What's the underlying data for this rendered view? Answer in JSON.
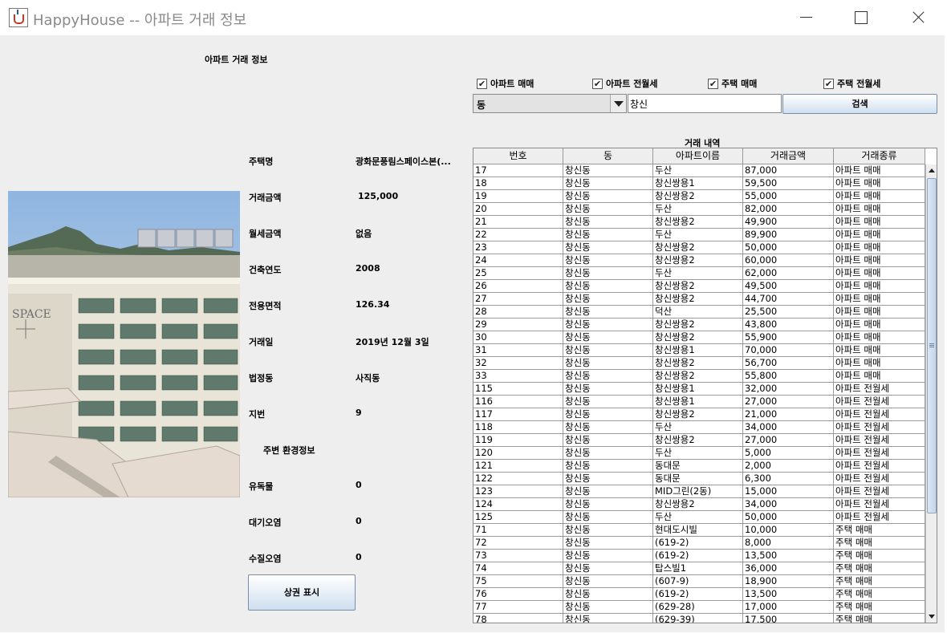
{
  "window": {
    "title": "HappyHouse -- 아파트 거래 정보",
    "icon": "java-cup-icon"
  },
  "header": {
    "title": "아파트 거래 정보"
  },
  "filters": {
    "checkboxes": [
      {
        "label": "아파트 매매",
        "checked": true
      },
      {
        "label": "아파트 전월세",
        "checked": true
      },
      {
        "label": "주택 매매",
        "checked": true
      },
      {
        "label": "주택 전월세",
        "checked": true
      }
    ],
    "check_mark": "✔",
    "category": {
      "selected": "동"
    },
    "query": {
      "value": "창신"
    },
    "search_label": "검색"
  },
  "detail": {
    "fields": [
      {
        "label": "주택명",
        "value": "광화문풍림스페이스본(..."
      },
      {
        "label": "거래금액",
        "value": "125,000"
      },
      {
        "label": "월세금액",
        "value": "없음"
      },
      {
        "label": "건축연도",
        "value": "2008"
      },
      {
        "label": "전용면적",
        "value": "126.34"
      },
      {
        "label": "거래일",
        "value": "2019년 12월 3일"
      },
      {
        "label": "법정동",
        "value": "사직동"
      },
      {
        "label": "지번",
        "value": "9"
      }
    ],
    "env_title": "주변 환경정보",
    "env_fields": [
      {
        "label": "유독물",
        "value": "0"
      },
      {
        "label": "대기오염",
        "value": "0"
      },
      {
        "label": "수질오염",
        "value": "0"
      }
    ],
    "map_button": "상권 표시",
    "photo_sign": "SPACE"
  },
  "deals": {
    "caption": "거래 내역",
    "columns": [
      "번호",
      "동",
      "아파트이름",
      "거래금액",
      "거래종류"
    ],
    "rows": [
      [
        "17",
        "창신동",
        "두산",
        "87,000",
        "아파트 매매"
      ],
      [
        "18",
        "창신동",
        "창신쌍용1",
        "59,500",
        "아파트 매매"
      ],
      [
        "19",
        "창신동",
        "창신쌍용2",
        "55,000",
        "아파트 매매"
      ],
      [
        "20",
        "창신동",
        "두산",
        "82,000",
        "아파트 매매"
      ],
      [
        "21",
        "창신동",
        "창신쌍용2",
        "49,900",
        "아파트 매매"
      ],
      [
        "22",
        "창신동",
        "두산",
        "89,900",
        "아파트 매매"
      ],
      [
        "23",
        "창신동",
        "창신쌍용2",
        "50,000",
        "아파트 매매"
      ],
      [
        "24",
        "창신동",
        "창신쌍용2",
        "60,000",
        "아파트 매매"
      ],
      [
        "25",
        "창신동",
        "두산",
        "62,000",
        "아파트 매매"
      ],
      [
        "26",
        "창신동",
        "창신쌍용2",
        "49,500",
        "아파트 매매"
      ],
      [
        "27",
        "창신동",
        "창신쌍용2",
        "44,700",
        "아파트 매매"
      ],
      [
        "28",
        "창신동",
        "덕산",
        "25,500",
        "아파트 매매"
      ],
      [
        "29",
        "창신동",
        "창신쌍용2",
        "43,800",
        "아파트 매매"
      ],
      [
        "30",
        "창신동",
        "창신쌍용2",
        "55,900",
        "아파트 매매"
      ],
      [
        "31",
        "창신동",
        "창신쌍용1",
        "70,000",
        "아파트 매매"
      ],
      [
        "32",
        "창신동",
        "창신쌍용2",
        "56,700",
        "아파트 매매"
      ],
      [
        "33",
        "창신동",
        "창신쌍용2",
        "55,800",
        "아파트 매매"
      ],
      [
        "115",
        "창신동",
        "창신쌍용1",
        "32,000",
        "아파트 전월세"
      ],
      [
        "116",
        "창신동",
        "창신쌍용1",
        "27,000",
        "아파트 전월세"
      ],
      [
        "117",
        "창신동",
        "창신쌍용2",
        "21,000",
        "아파트 전월세"
      ],
      [
        "118",
        "창신동",
        "두산",
        "34,000",
        "아파트 전월세"
      ],
      [
        "119",
        "창신동",
        "창신쌍용2",
        "27,000",
        "아파트 전월세"
      ],
      [
        "120",
        "창신동",
        "두산",
        "5,000",
        "아파트 전월세"
      ],
      [
        "121",
        "창신동",
        "동대문",
        "2,000",
        "아파트 전월세"
      ],
      [
        "122",
        "창신동",
        "동대문",
        "6,300",
        "아파트 전월세"
      ],
      [
        "123",
        "창신동",
        "MID그린(2동)",
        "15,000",
        "아파트 전월세"
      ],
      [
        "124",
        "창신동",
        "창신쌍용2",
        "34,000",
        "아파트 전월세"
      ],
      [
        "125",
        "창신동",
        "두산",
        "50,000",
        "아파트 전월세"
      ],
      [
        "71",
        "창신동",
        "현대도시빌",
        "10,000",
        "주택 매매"
      ],
      [
        "72",
        "창신동",
        "(619-2)",
        "8,000",
        "주택 매매"
      ],
      [
        "73",
        "창신동",
        "(619-2)",
        "13,500",
        "주택 매매"
      ],
      [
        "74",
        "창신동",
        "탑스빌1",
        "36,000",
        "주택 매매"
      ],
      [
        "75",
        "창신동",
        "(607-9)",
        "18,900",
        "주택 매매"
      ],
      [
        "76",
        "창신동",
        "(619-2)",
        "13,500",
        "주택 매매"
      ],
      [
        "77",
        "창신동",
        "(629-28)",
        "17,000",
        "주택 매매"
      ],
      [
        "78",
        "창신동",
        "(629-39)",
        "17,500",
        "주택 매매"
      ]
    ]
  }
}
